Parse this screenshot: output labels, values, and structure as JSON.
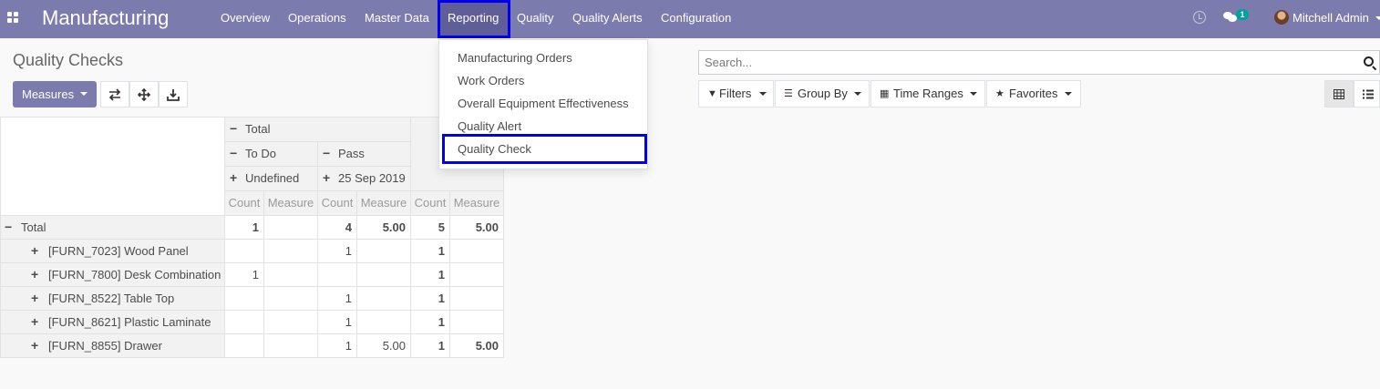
{
  "navbar": {
    "app_title": "Manufacturing",
    "menu": [
      "Overview",
      "Operations",
      "Master Data",
      "Reporting",
      "Quality",
      "Quality Alerts",
      "Configuration"
    ],
    "active_menu": "Reporting",
    "chat_badge": "1",
    "user_name": "Mitchell Admin",
    "bar_color": "#7c7bad"
  },
  "reporting_dropdown": {
    "items": [
      "Manufacturing Orders",
      "Work Orders",
      "Overall Equipment Effectiveness",
      "Quality Alert",
      "Quality Check"
    ],
    "highlighted": "Quality Check"
  },
  "control_panel": {
    "breadcrumb": "Quality Checks",
    "measures_label": "Measures",
    "search_placeholder": "Search...",
    "filters_label": "Filters",
    "group_by_label": "Group By",
    "time_ranges_label": "Time Ranges",
    "favorites_label": "Favorites",
    "active_view": "pivot"
  },
  "pivot": {
    "col_total": "Total",
    "col_groups": [
      "To Do",
      "Pass"
    ],
    "col_subgroups": [
      "Undefined",
      "25 Sep 2019"
    ],
    "measure_headers": [
      "Count",
      "Measure",
      "Count",
      "Measure",
      "Count",
      "Measure"
    ],
    "total_row": {
      "label": "Total",
      "values": [
        "1",
        "",
        "4",
        "5.00",
        "5",
        "5.00"
      ]
    },
    "rows": [
      {
        "label": "[FURN_7023] Wood Panel",
        "values": [
          "",
          "",
          "1",
          "",
          "1",
          ""
        ]
      },
      {
        "label": "[FURN_7800] Desk Combination",
        "values": [
          "1",
          "",
          "",
          "",
          "1",
          ""
        ]
      },
      {
        "label": "[FURN_8522] Table Top",
        "values": [
          "",
          "",
          "1",
          "",
          "1",
          ""
        ]
      },
      {
        "label": "[FURN_8621] Plastic Laminate",
        "values": [
          "",
          "",
          "1",
          "",
          "1",
          ""
        ]
      },
      {
        "label": "[FURN_8855] Drawer",
        "values": [
          "",
          "",
          "1",
          "5.00",
          "1",
          "5.00"
        ]
      }
    ]
  }
}
